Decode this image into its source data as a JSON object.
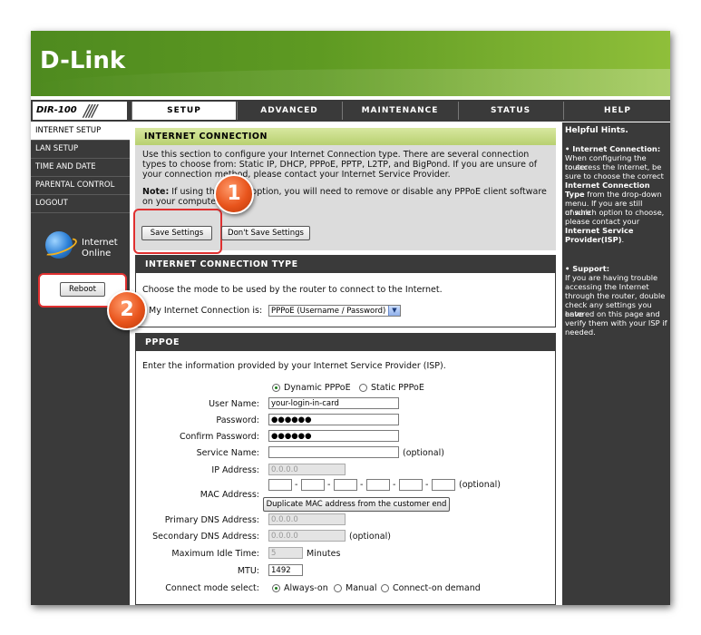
{
  "brand": {
    "logo": "D-Link",
    "model": "DIR-100"
  },
  "tabs": [
    {
      "label": "SETUP",
      "active": true
    },
    {
      "label": "ADVANCED",
      "active": false
    },
    {
      "label": "MAINTENANCE",
      "active": false
    },
    {
      "label": "STATUS",
      "active": false
    },
    {
      "label": "HELP",
      "active": false
    }
  ],
  "sidebar": {
    "items": [
      {
        "label": "INTERNET SETUP",
        "active": true
      },
      {
        "label": "LAN SETUP",
        "active": false
      },
      {
        "label": "TIME AND DATE",
        "active": false
      },
      {
        "label": "PARENTAL CONTROL",
        "active": false
      },
      {
        "label": "LOGOUT",
        "active": false
      }
    ],
    "status_line1": "Internet",
    "status_line2": "Online",
    "reboot_label": "Reboot"
  },
  "internet_connection": {
    "title": "INTERNET CONNECTION",
    "desc_line1": "Use this section to configure your Internet Connection type. There are several connection",
    "desc_line2": "types to choose from: Static IP, DHCP, PPPoE, PPTP, L2TP, and BigPond. If you are unsure of",
    "desc_line3": "your connection method, please contact your Internet Service Provider.",
    "note_bold": "Note:",
    "note_line1": "If using the PPPoE option, you will need to remove or disable any PPPoE client software",
    "note_line2": "on your computers.",
    "save_label": "Save Settings",
    "dont_save_label": "Don't Save Settings"
  },
  "connection_type": {
    "title": "INTERNET CONNECTION TYPE",
    "desc": "Choose the mode to be used by the router to connect to the Internet.",
    "label": "My Internet Connection is:",
    "selected": "PPPoE (Username / Password)"
  },
  "pppoe": {
    "title": "PPPOE",
    "desc": "Enter the information provided by your Internet Service Provider (ISP).",
    "dynamic_label": "Dynamic PPPoE",
    "static_label": "Static PPPoE",
    "user_name_label": "User Name:",
    "user_name_value": "your-login-in-card",
    "password_label": "Password:",
    "password_value": "●●●●●●",
    "confirm_password_label": "Confirm Password:",
    "confirm_password_value": "●●●●●●",
    "service_name_label": "Service Name:",
    "service_name_value": "",
    "optional": "(optional)",
    "ip_address_label": "IP Address:",
    "ip_address_value": "0.0.0.0",
    "mac_address_label": "MAC Address:",
    "mac_dash": "-",
    "duplicate_mac_label": "Duplicate MAC address from the customer end",
    "primary_dns_label": "Primary DNS Address:",
    "primary_dns_value": "0.0.0.0",
    "secondary_dns_label": "Secondary DNS Address:",
    "secondary_dns_value": "0.0.0.0",
    "idle_time_label": "Maximum Idle Time:",
    "idle_time_value": "5",
    "minutes": "Minutes",
    "mtu_label": "MTU:",
    "mtu_value": "1492",
    "connect_mode_label": "Connect mode select:",
    "always_on_label": "Always-on",
    "manual_label": "Manual",
    "on_demand_label": "Connect-on demand"
  },
  "help": {
    "title": "Helpful Hints.",
    "bullet": "•",
    "ic_head": "Internet Connection:",
    "ic_l1": "When configuring the router",
    "ic_l2": "to access the Internet, be",
    "ic_l3": "sure to choose the correct",
    "ic_b1": "Internet Connection",
    "ic_b2": "Type",
    "ic_l4": "from the drop-down",
    "ic_l5": "menu. If you are still unsure",
    "ic_l6": "of which option to choose,",
    "ic_l7": "please contact your",
    "ic_b3": "Internet Service",
    "ic_b4": "Provider(ISP)",
    "ic_dot": ".",
    "sup_head": "Support:",
    "sup_l1": "If you are having trouble",
    "sup_l2": "accessing the Internet",
    "sup_l3": "through the router, double",
    "sup_l4": "check any settings you have",
    "sup_l5": "entered on this page and",
    "sup_l6": "verify them with your ISP if",
    "sup_l7": "needed."
  },
  "callouts": {
    "one": "1",
    "two": "2"
  }
}
